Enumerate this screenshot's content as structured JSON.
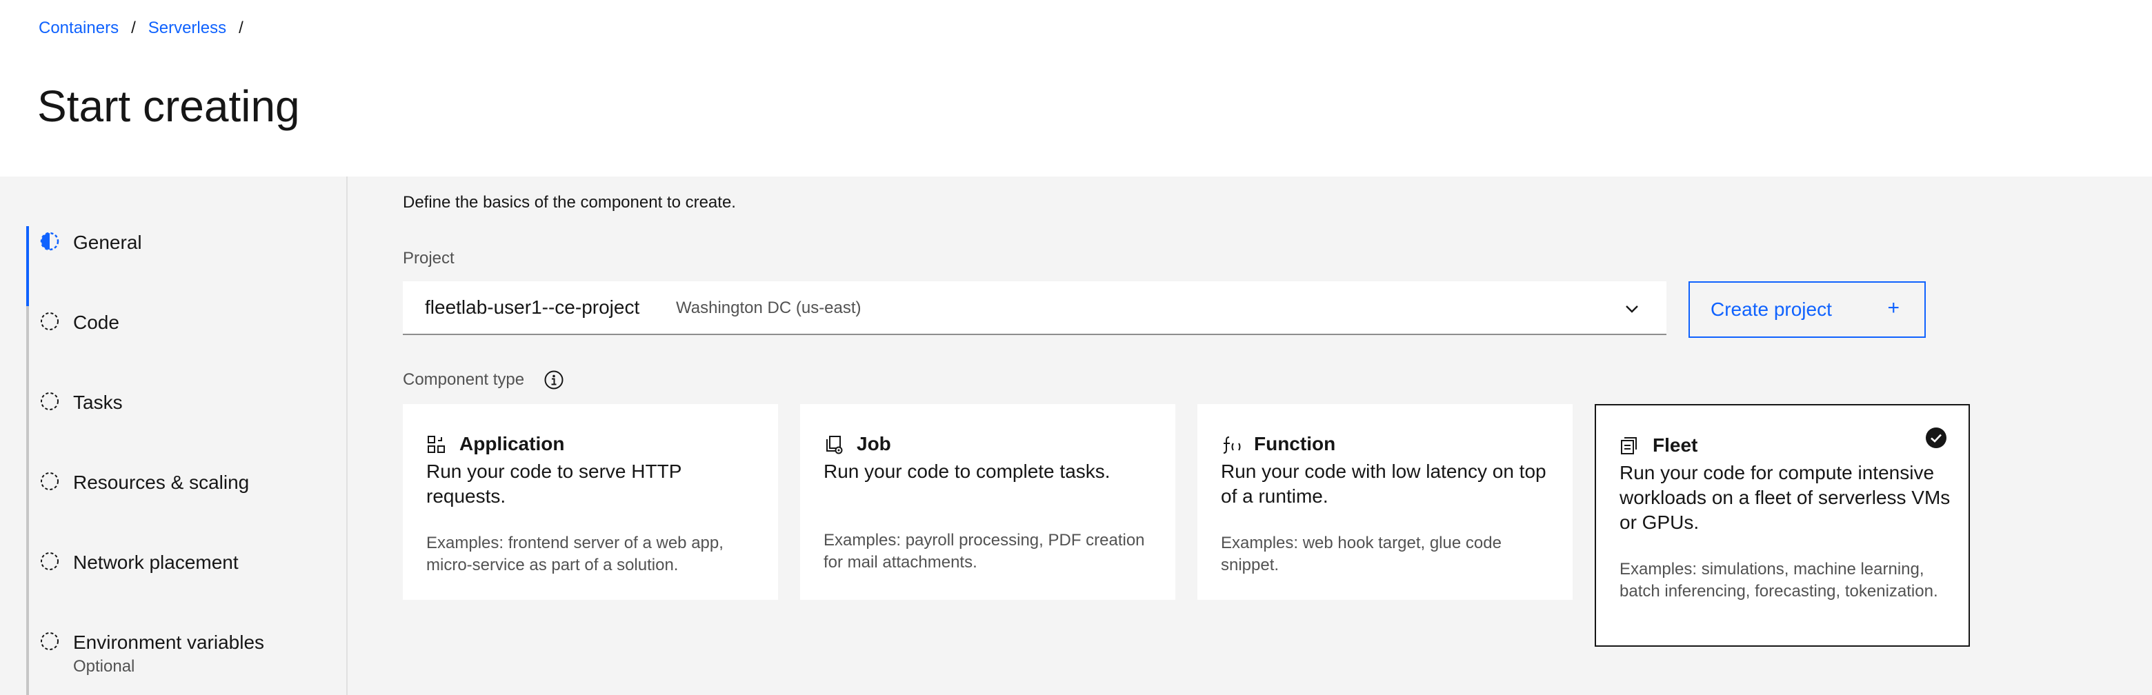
{
  "breadcrumb": {
    "items": [
      "Containers",
      "Serverless"
    ],
    "separator": "/"
  },
  "page": {
    "title": "Start creating"
  },
  "steps": [
    {
      "label": "General",
      "state": "current"
    },
    {
      "label": "Code",
      "state": "incomplete"
    },
    {
      "label": "Tasks",
      "state": "incomplete"
    },
    {
      "label": "Resources & scaling",
      "state": "incomplete"
    },
    {
      "label": "Network placement",
      "state": "incomplete"
    },
    {
      "label": "Environment variables",
      "state": "incomplete",
      "sublabel": "Optional"
    }
  ],
  "form": {
    "description": "Define the basics of the component to create.",
    "project_label": "Project",
    "project_value": "fleetlab-user1--ce-project",
    "project_region": "Washington DC (us-east)",
    "create_project_label": "Create project",
    "component_type_label": "Component type"
  },
  "component_types": [
    {
      "icon": "application-icon",
      "title": "Application",
      "description": "Run your code to serve HTTP requests.",
      "examples": "Examples: frontend server of a web app, micro-service as part of a solution.",
      "selected": false
    },
    {
      "icon": "job-icon",
      "title": "Job",
      "description": "Run your code to complete tasks.",
      "examples": "Examples: payroll processing, PDF creation for mail attachments.",
      "selected": false
    },
    {
      "icon": "function-icon",
      "title": "Function",
      "description": "Run your code with low latency on top of a runtime.",
      "examples": "Examples: web hook target, glue code snippet.",
      "selected": false
    },
    {
      "icon": "fleet-icon",
      "title": "Fleet",
      "description": "Run your code for compute intensive workloads on a fleet of serverless VMs or GPUs.",
      "examples": "Examples: simulations, machine learning, batch inferencing, forecasting, tokenization.",
      "selected": true
    }
  ],
  "colors": {
    "accent": "#0f62fe",
    "text": "#161616",
    "secondary_text": "#525252",
    "background": "#f4f4f4"
  }
}
